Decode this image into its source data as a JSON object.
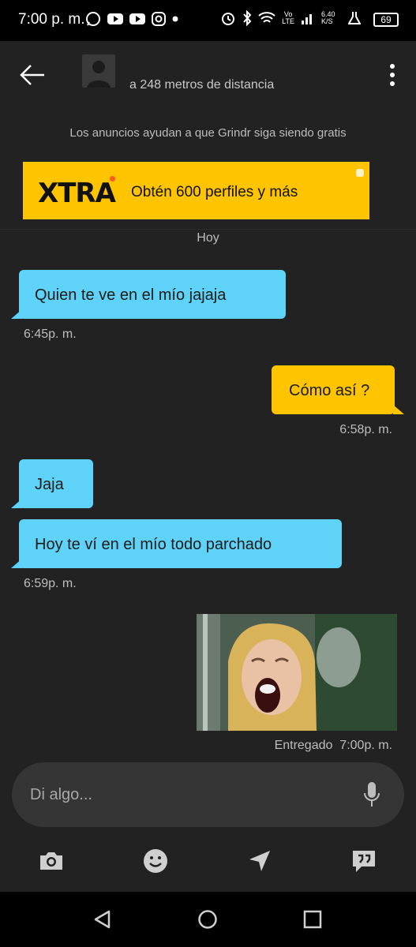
{
  "status_bar": {
    "time": "7:00 p. m.",
    "battery": "69",
    "speed": "6.40 K/S"
  },
  "header": {
    "distance": "a 248 metros de distancia"
  },
  "ads": {
    "note": "Los anuncios ayudan a que Grindr siga siendo gratis",
    "logo": "XTRA",
    "text": "Obtén 600 perfiles y más"
  },
  "chat": {
    "day": "Hoy",
    "messages": [
      {
        "text": "Quien te ve en el mío jajaja",
        "time": "6:45p. m."
      },
      {
        "text": "Cómo así ?",
        "time": "6:58p. m."
      },
      {
        "text": "Jaja"
      },
      {
        "text": "Hoy te ví en el mío todo parchado",
        "time": "6:59p. m."
      },
      {
        "status": "Entregado",
        "time": "7:00p. m."
      }
    ]
  },
  "composer": {
    "placeholder": "Di algo..."
  },
  "icons": [
    "back-arrow-icon",
    "more-vert-icon",
    "camera-icon",
    "sticker-icon",
    "location-icon",
    "quick-reply-icon",
    "mic-icon"
  ],
  "colors": {
    "incoming": "#5fd3f7",
    "outgoing": "#ffc400",
    "background": "#222222"
  }
}
